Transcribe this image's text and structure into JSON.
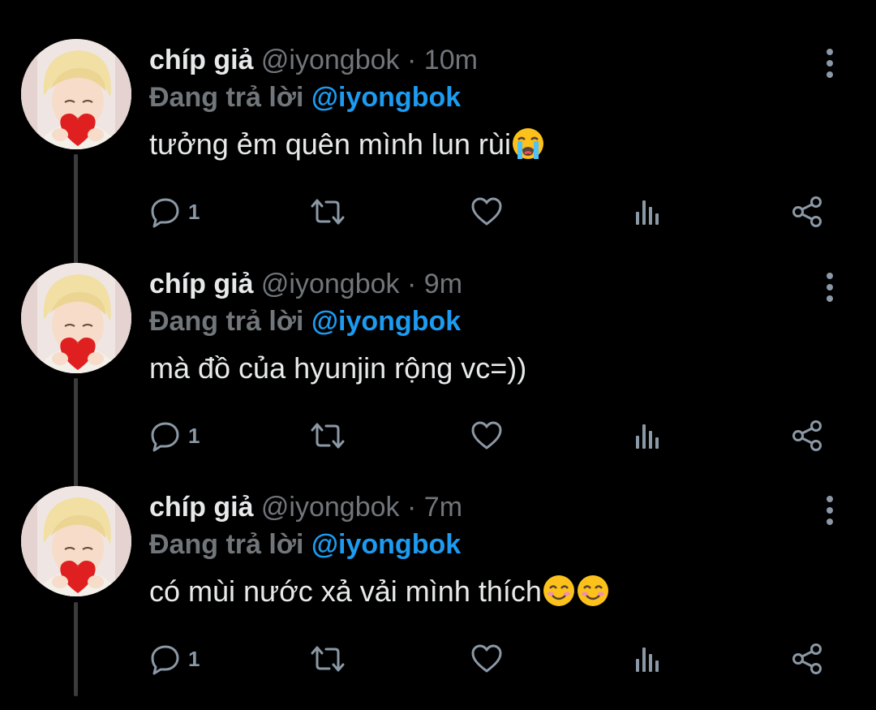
{
  "colors": {
    "background": "#000000",
    "text_primary": "#e7e9ea",
    "text_secondary": "#71767b",
    "accent": "#1d9bf0",
    "icon": "#8b98a5"
  },
  "tweets": [
    {
      "name": "chíp giả",
      "handle": "@iyongbok",
      "separator": "·",
      "time": "10m",
      "reply_prefix": "Đang trả lời",
      "reply_to": "@iyongbok",
      "text": "tưởng ẻm quên mình lun rùi",
      "emojis": [
        "loudly-crying-face-emoji"
      ],
      "reply_count": "1"
    },
    {
      "name": "chíp giả",
      "handle": "@iyongbok",
      "separator": "·",
      "time": "9m",
      "reply_prefix": "Đang trả lời",
      "reply_to": "@iyongbok",
      "text": "mà đồ của hyunjin rộng vc=))",
      "emojis": [],
      "reply_count": "1"
    },
    {
      "name": "chíp giả",
      "handle": "@iyongbok",
      "separator": "·",
      "time": "7m",
      "reply_prefix": "Đang trả lời",
      "reply_to": "@iyongbok",
      "text": "có mùi nước xả vải mình thích",
      "emojis": [
        "smiling-face-emoji",
        "smiling-face-emoji"
      ],
      "reply_count": "1"
    }
  ],
  "action_icons": [
    "reply-icon",
    "retweet-icon",
    "like-icon",
    "analytics-icon",
    "share-icon"
  ]
}
